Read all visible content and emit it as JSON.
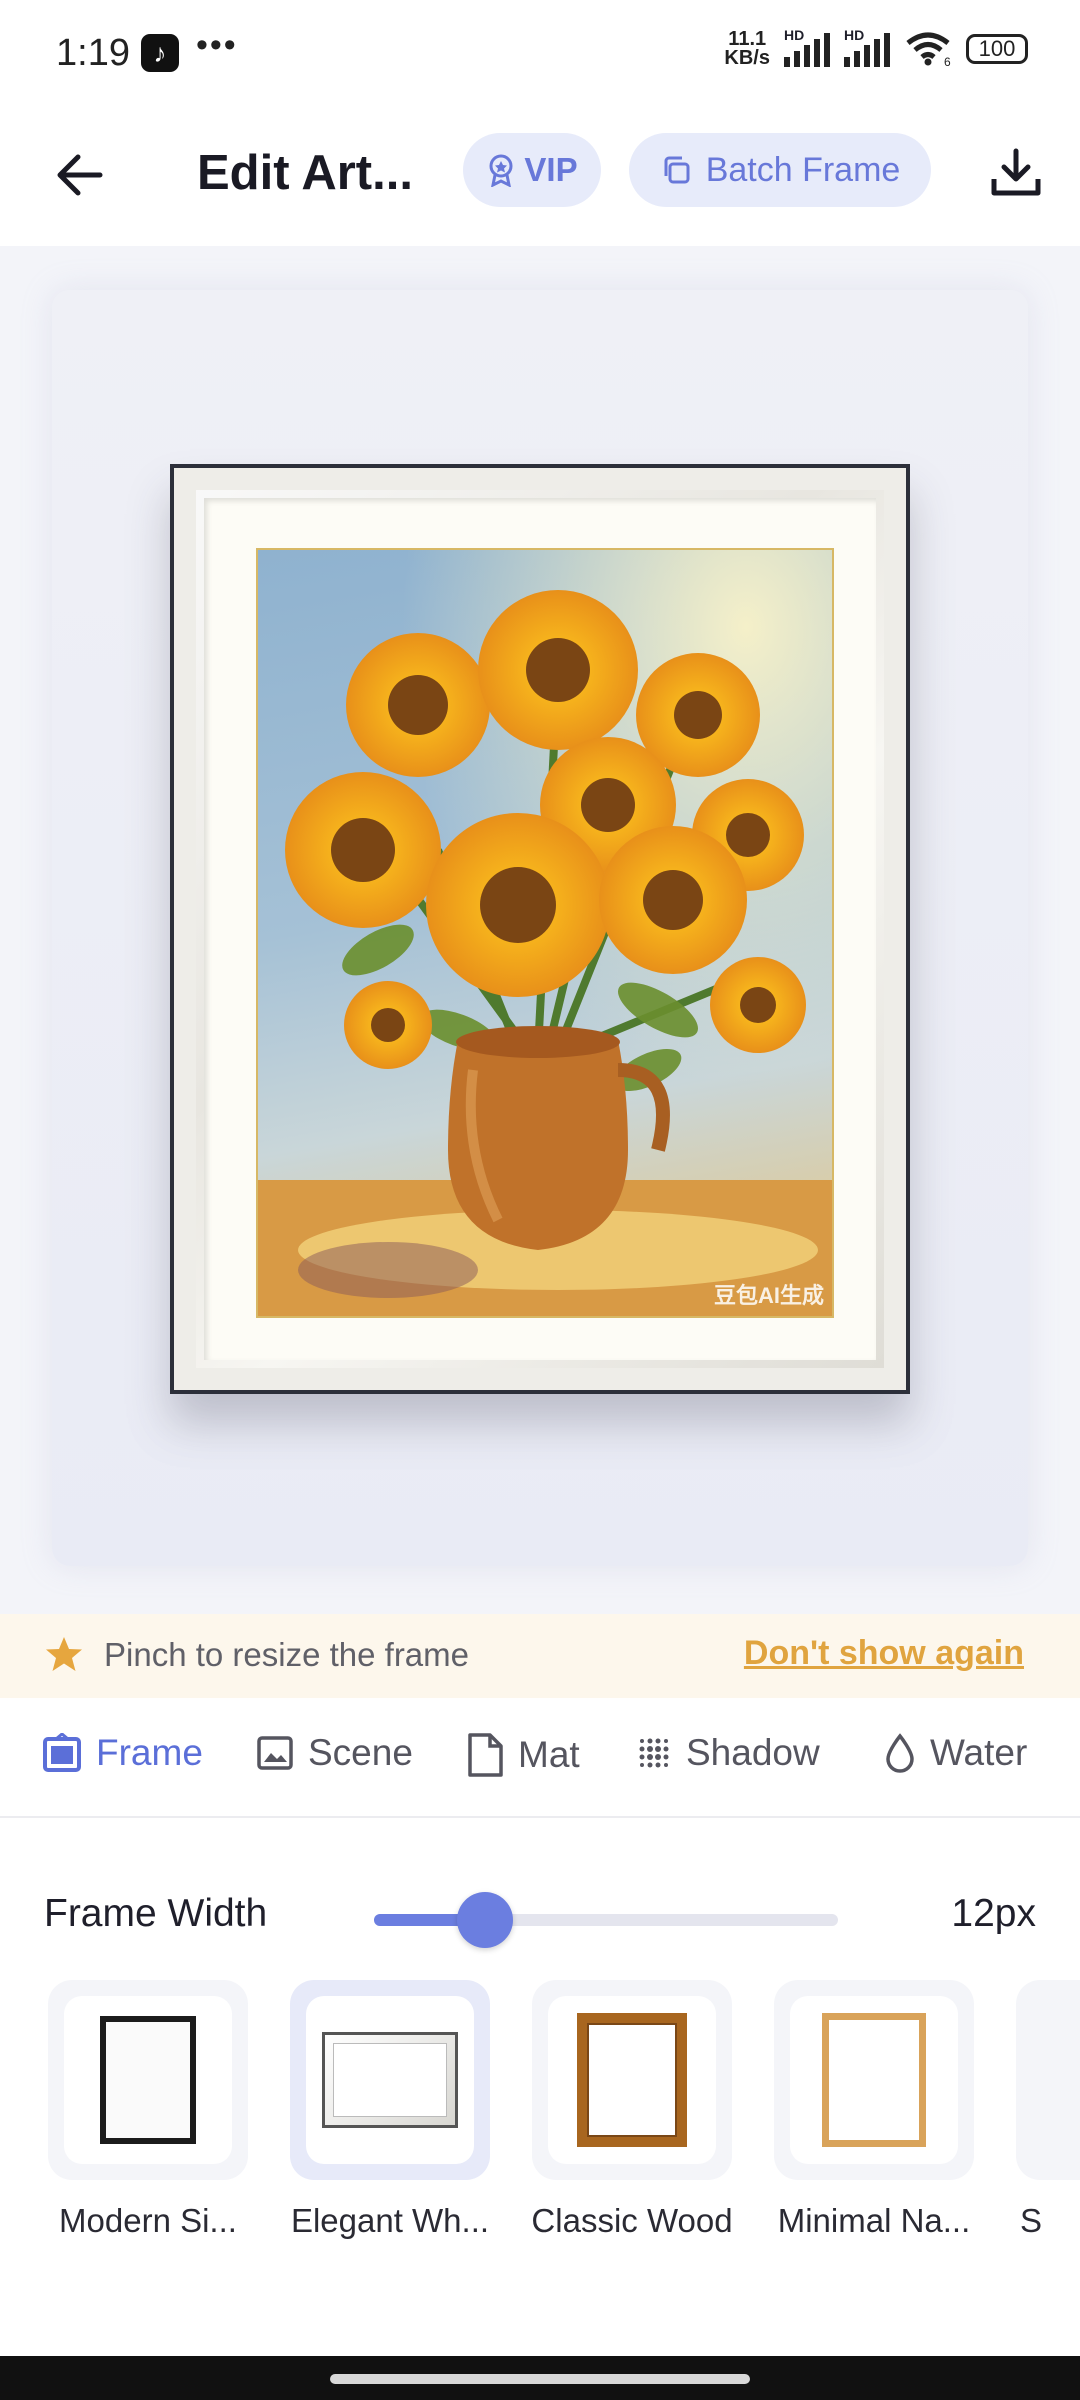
{
  "status_bar": {
    "time": "1:19",
    "net_speed_value": "11.1",
    "net_speed_unit": "KB/s",
    "hd_1": "HD",
    "hd_2": "HD",
    "wifi_badge": "6",
    "battery": "100"
  },
  "header": {
    "title": "Edit Art...",
    "vip_label": "VIP",
    "batch_label": "Batch Frame"
  },
  "artwork": {
    "watermark": "豆包AI生成"
  },
  "tip": {
    "text": "Pinch to resize the frame",
    "dismiss_label": "Don't show again"
  },
  "tabs": [
    {
      "label": "Frame",
      "icon": "frame-icon",
      "active": true
    },
    {
      "label": "Scene",
      "icon": "image-icon",
      "active": false
    },
    {
      "label": "Mat",
      "icon": "document-icon",
      "active": false
    },
    {
      "label": "Shadow",
      "icon": "dots-grid-icon",
      "active": false
    },
    {
      "label": "Water",
      "icon": "droplet-icon",
      "active": false
    }
  ],
  "frame_width": {
    "label": "Frame Width",
    "value_text": "12px",
    "fraction": 0.24
  },
  "frame_styles": [
    {
      "label": "Modern Si...",
      "selected": false
    },
    {
      "label": "Elegant Wh...",
      "selected": true
    },
    {
      "label": "Classic Wood",
      "selected": false
    },
    {
      "label": "Minimal Na...",
      "selected": false
    },
    {
      "label": "S",
      "selected": false
    }
  ],
  "colors": {
    "accent": "#6b7ee0",
    "tip_link": "#e0a43f",
    "tip_bg": "#fdf7ec"
  }
}
